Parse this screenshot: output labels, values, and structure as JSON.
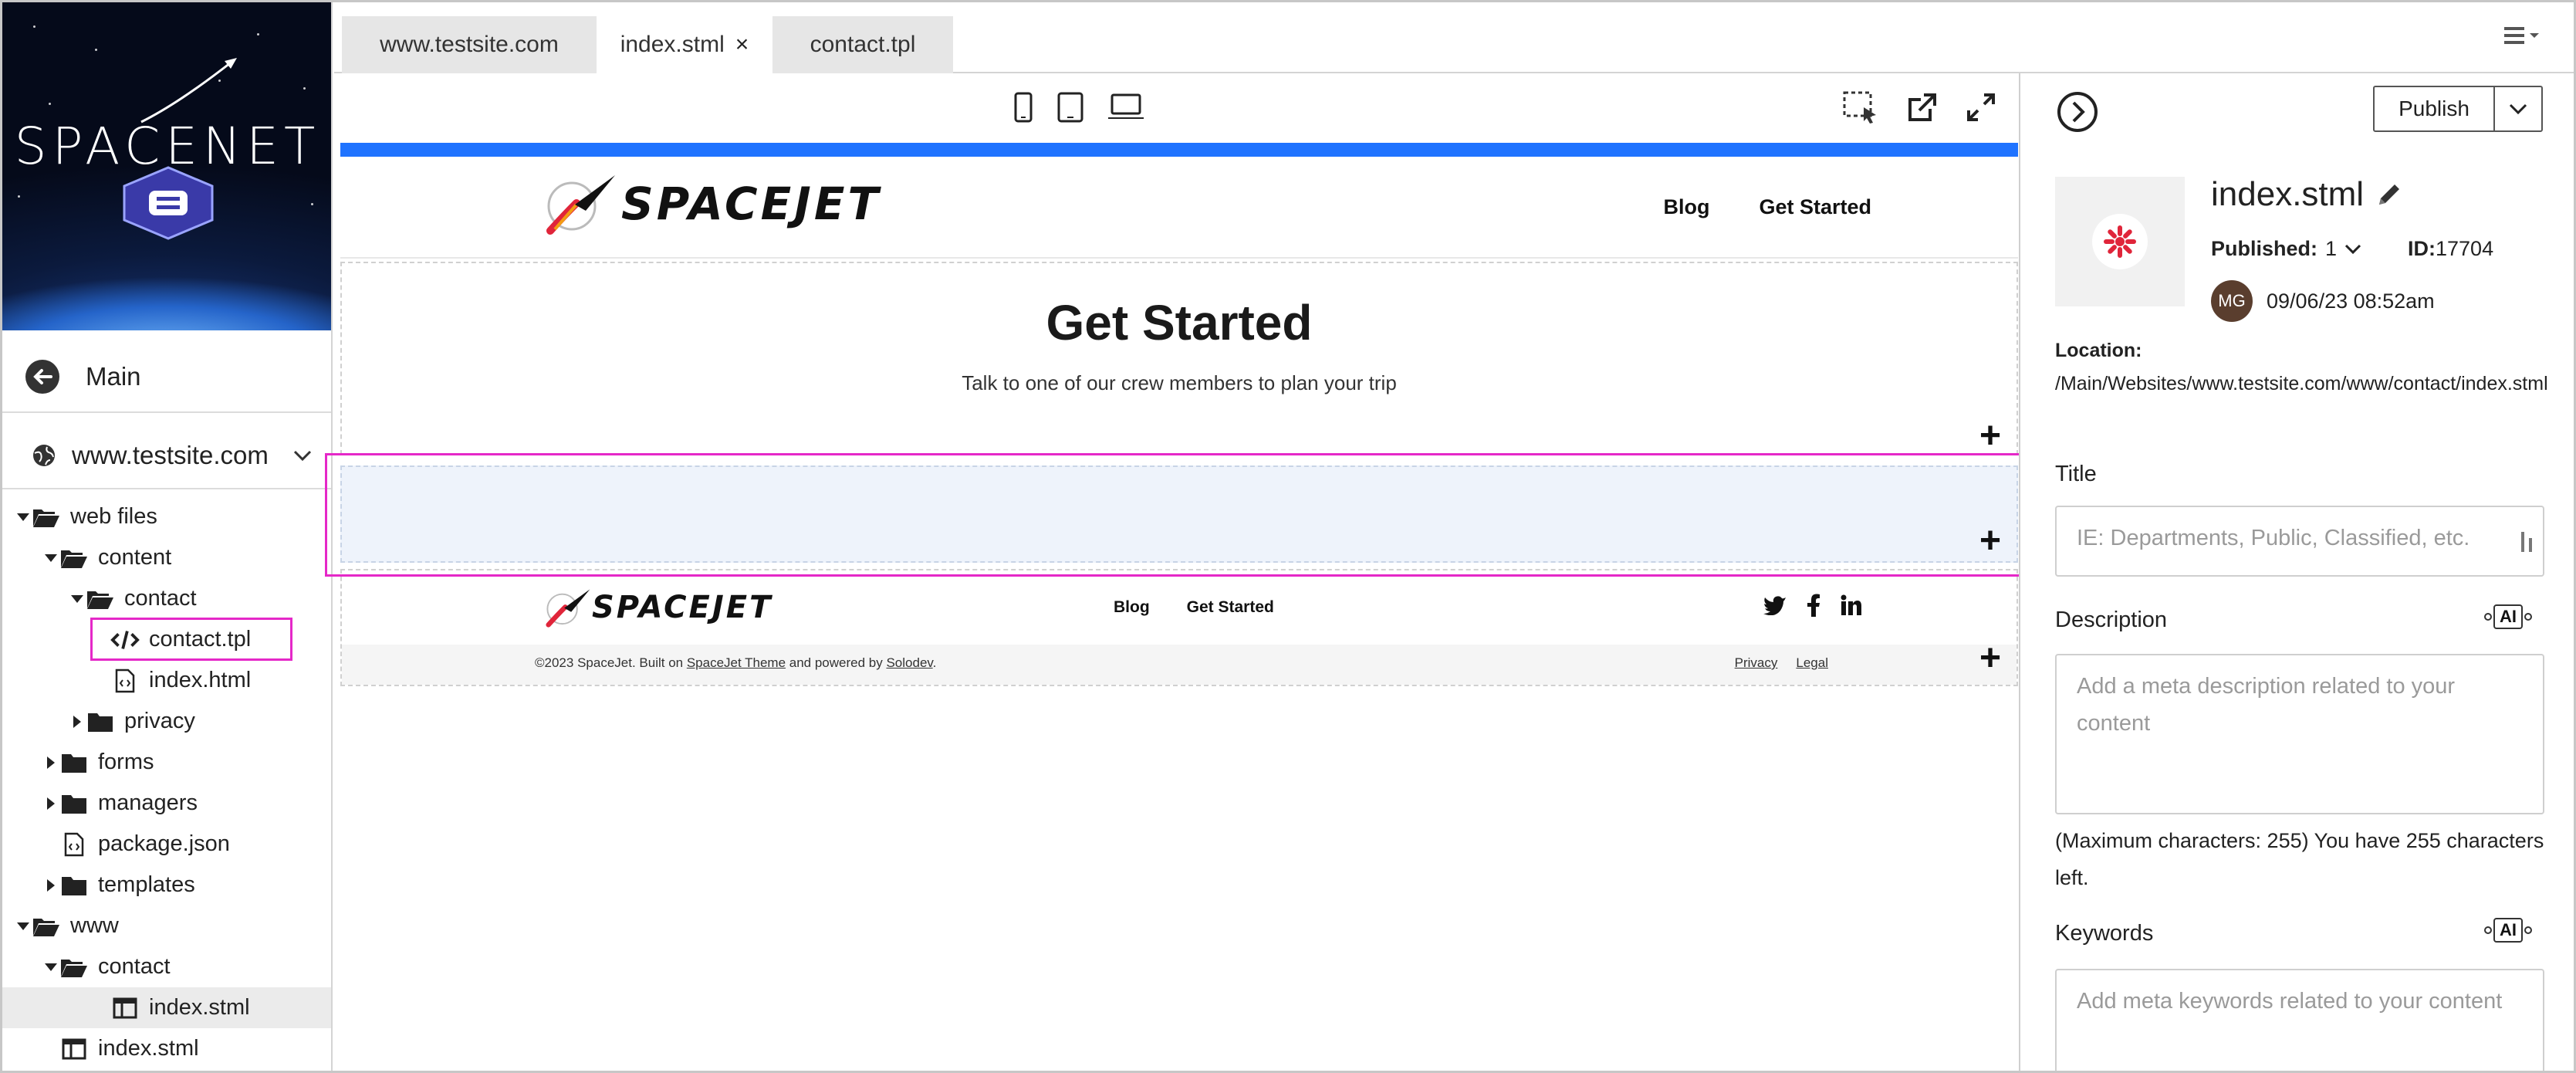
{
  "tabs": [
    {
      "label": "www.testsite.com",
      "active": false
    },
    {
      "label": "index.stml",
      "active": true,
      "close": "×"
    },
    {
      "label": "contact.tpl",
      "active": false
    }
  ],
  "sidebar": {
    "brand_name": "SPACENET",
    "main_label": "Main",
    "site_label": "www.testsite.com",
    "tree": [
      {
        "label": "web files",
        "level": 0,
        "type": "folder-open",
        "caret": "down"
      },
      {
        "label": "content",
        "level": 1,
        "type": "folder-open",
        "caret": "down"
      },
      {
        "label": "contact",
        "level": 2,
        "type": "folder-open",
        "caret": "down"
      },
      {
        "label": "contact.tpl",
        "level": 3,
        "type": "code-file",
        "caret": "none"
      },
      {
        "label": "index.html",
        "level": 3,
        "type": "html-file",
        "caret": "none"
      },
      {
        "label": "privacy",
        "level": 2,
        "type": "folder",
        "caret": "right"
      },
      {
        "label": "forms",
        "level": 1,
        "type": "folder",
        "caret": "right"
      },
      {
        "label": "managers",
        "level": 1,
        "type": "folder",
        "caret": "right"
      },
      {
        "label": "package.json",
        "level": 1,
        "type": "json-file",
        "caret": "none"
      },
      {
        "label": "templates",
        "level": 1,
        "type": "folder",
        "caret": "right"
      },
      {
        "label": "www",
        "level": 0,
        "type": "folder-open",
        "caret": "down"
      },
      {
        "label": "contact",
        "level": 1,
        "type": "folder-open",
        "caret": "down"
      },
      {
        "label": "index.stml",
        "level": 3,
        "type": "page-file",
        "caret": "none",
        "selected": true
      },
      {
        "label": "index.stml",
        "level": 1,
        "type": "page-file",
        "caret": "none"
      }
    ]
  },
  "preview": {
    "logo_text": "SPACEJET",
    "nav": [
      "Blog",
      "Get Started"
    ],
    "hero_title": "Get Started",
    "hero_subtitle": "Talk to one of our crew members to plan your trip",
    "plus": "+",
    "footer_logo_text": "SPACEJET",
    "footer_nav": [
      "Blog",
      "Get Started"
    ],
    "copyright_pre": "©2023 SpaceJet. Built on ",
    "copyright_theme": "SpaceJet Theme",
    "copyright_mid": " and powered by ",
    "copyright_vendor": "Solodev",
    "copyright_post": ".",
    "footer_links": [
      "Privacy",
      "Legal"
    ]
  },
  "panel": {
    "publish_label": "Publish",
    "file_name": "index.stml",
    "published_label": "Published:",
    "published_value": "1",
    "id_label": "ID:",
    "id_value": "17704",
    "avatar_initials": "MG",
    "modified": "09/06/23 08:52am",
    "location_label": "Location:",
    "location_value": "/Main/Websites/www.testsite.com/www/contact/index.stml",
    "title_label": "Title",
    "title_placeholder": "IE: Departments, Public, Classified, etc.",
    "description_label": "Description",
    "description_placeholder": "Add a meta description related to your content",
    "max_chars_note": "(Maximum characters: 255) You have 255 characters left.",
    "keywords_label": "Keywords",
    "keywords_placeholder": "Add meta keywords related to your content",
    "ai_label": "AI"
  },
  "colors": {
    "accent_blue": "#1f73ff",
    "highlight_magenta": "#e528c8",
    "empty_section_bg": "#eef3fb",
    "logo_red": "#e0253a"
  }
}
